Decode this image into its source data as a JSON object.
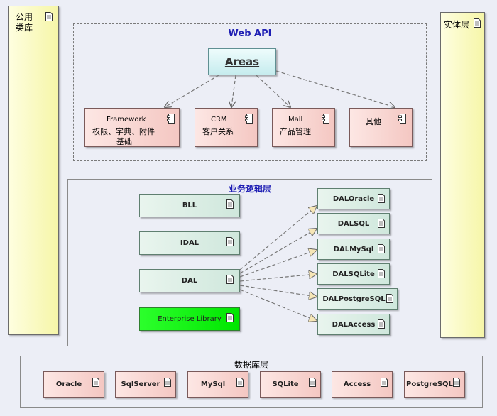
{
  "left_panel": {
    "line1": "公用",
    "line2": "类库"
  },
  "right_panel": {
    "label": "实体层"
  },
  "web_api": {
    "title": "Web API",
    "areas": "Areas",
    "modules": [
      {
        "line1": "Framework",
        "line2": "权限、字典、附件",
        "line3": "基础"
      },
      {
        "line1": "CRM",
        "line2": "客户关系"
      },
      {
        "line1": "Mall",
        "line2": "产品管理"
      },
      {
        "line1": "其他"
      }
    ]
  },
  "business": {
    "title": "业务逻辑层",
    "left_items": [
      "BLL",
      "IDAL",
      "DAL",
      "Enterprise Library"
    ],
    "dal_impls": [
      "DALOracle",
      "DALSQL",
      "DALMySql",
      "DALSQLite",
      "DALPostgreSQL",
      "DALAccess"
    ]
  },
  "database": {
    "title": "数据库层",
    "items": [
      "Oracle",
      "SqlServer",
      "MySql",
      "SQLite",
      "Access",
      "PostgreSQL"
    ]
  },
  "colors": {
    "title_blue": "#1f1fb4",
    "component_pink": "#f4c7c2",
    "artifact_green": "#cfe7dc",
    "enterprise_green": "#00e600",
    "package_yellow": "#f6f6a8"
  }
}
